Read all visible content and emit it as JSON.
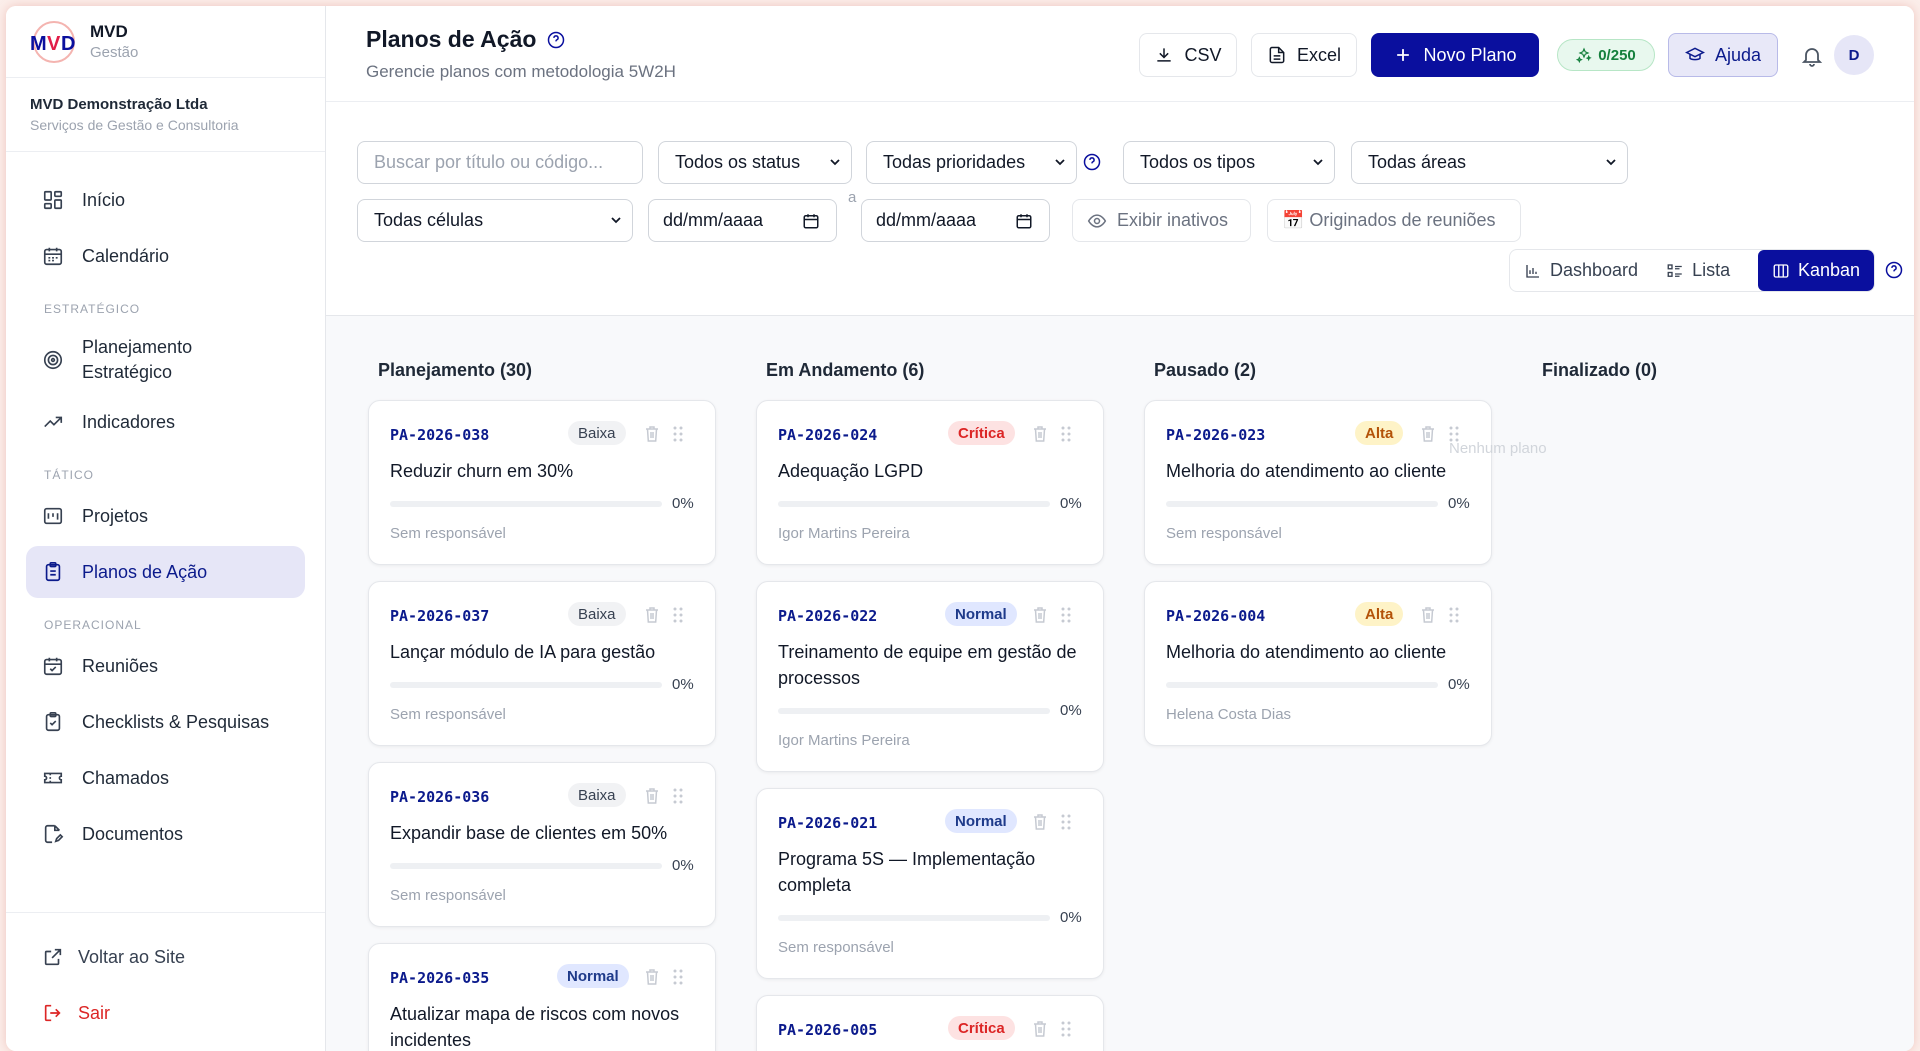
{
  "brand": {
    "name": "MVD",
    "subtitle": "Gestão"
  },
  "company": {
    "name": "MVD Demonstração Ltda",
    "subtitle": "Serviços de Gestão e Consultoria"
  },
  "nav": {
    "inicio": "Início",
    "calendario": "Calendário",
    "section_estrategico": "ESTRATÉGICO",
    "planejamento_line1": "Planejamento",
    "planejamento_line2": "Estratégico",
    "indicadores": "Indicadores",
    "section_tatico": "TÁTICO",
    "projetos": "Projetos",
    "planos": "Planos de Ação",
    "section_operacional": "OPERACIONAL",
    "reunioes": "Reuniões",
    "checklists": "Checklists & Pesquisas",
    "chamados": "Chamados",
    "documentos": "Documentos",
    "voltar": "Voltar ao Site",
    "sair": "Sair"
  },
  "header": {
    "title": "Planos de Ação",
    "subtitle": "Gerencie planos com metodologia 5W2H",
    "csv": "CSV",
    "excel": "Excel",
    "novo": "Novo Plano",
    "counter": "0/250",
    "ajuda": "Ajuda",
    "avatar": "D"
  },
  "filters": {
    "search_placeholder": "Buscar por título ou código...",
    "status": "Todos os status",
    "prioridades": "Todas prioridades",
    "tipos": "Todos os tipos",
    "areas": "Todas áreas",
    "celulas": "Todas células",
    "date_from": "dd/mm/aaaa",
    "date_sep": "a",
    "date_to": "dd/mm/aaaa",
    "inativos": "Exibir inativos",
    "reunioes": "📅 Originados de reuniões"
  },
  "views": {
    "dashboard": "Dashboard",
    "lista": "Lista",
    "kanban": "Kanban"
  },
  "columns": {
    "planejamento": "Planejamento (30)",
    "andamento": "Em Andamento (6)",
    "pausado": "Pausado (2)",
    "finalizado": "Finalizado (0)",
    "empty": "Nenhum plano"
  },
  "cards": {
    "c1": {
      "code": "PA-2026-038",
      "priority": "Baixa",
      "title": "Reduzir churn em 30%",
      "progress": 0,
      "pct": "0%",
      "owner": "Sem responsável"
    },
    "c2": {
      "code": "PA-2026-037",
      "priority": "Baixa",
      "title": "Lançar módulo de IA para gestão",
      "progress": 0,
      "pct": "0%",
      "owner": "Sem responsável"
    },
    "c3": {
      "code": "PA-2026-036",
      "priority": "Baixa",
      "title": "Expandir base de clientes em 50%",
      "progress": 0,
      "pct": "0%",
      "owner": "Sem responsável"
    },
    "c4": {
      "code": "PA-2026-035",
      "priority": "Normal",
      "title": "Atualizar mapa de riscos com novos incidentes"
    },
    "d1": {
      "code": "PA-2026-024",
      "priority": "Crítica",
      "title": "Adequação LGPD",
      "progress": 0,
      "pct": "0%",
      "owner": "Igor Martins Pereira"
    },
    "d2": {
      "code": "PA-2026-022",
      "priority": "Normal",
      "title": "Treinamento de equipe em gestão de processos",
      "progress": 0,
      "pct": "0%",
      "owner": "Igor Martins Pereira"
    },
    "d3": {
      "code": "PA-2026-021",
      "priority": "Normal",
      "title": "Programa 5S — Implementação completa",
      "progress": 0,
      "pct": "0%",
      "owner": "Sem responsável"
    },
    "d4": {
      "code": "PA-2026-005",
      "priority": "Crítica"
    },
    "e1": {
      "code": "PA-2026-023",
      "priority": "Alta",
      "title": "Melhoria do atendimento ao cliente",
      "progress": 0,
      "pct": "0%",
      "owner": "Sem responsável"
    },
    "e2": {
      "code": "PA-2026-004",
      "priority": "Alta",
      "title": "Melhoria do atendimento ao cliente",
      "progress": 0,
      "pct": "0%",
      "owner": "Helena Costa Dias"
    }
  },
  "colors": {
    "primary": "#0a0f9e",
    "danger": "#dc2626",
    "success": "#15803d"
  }
}
